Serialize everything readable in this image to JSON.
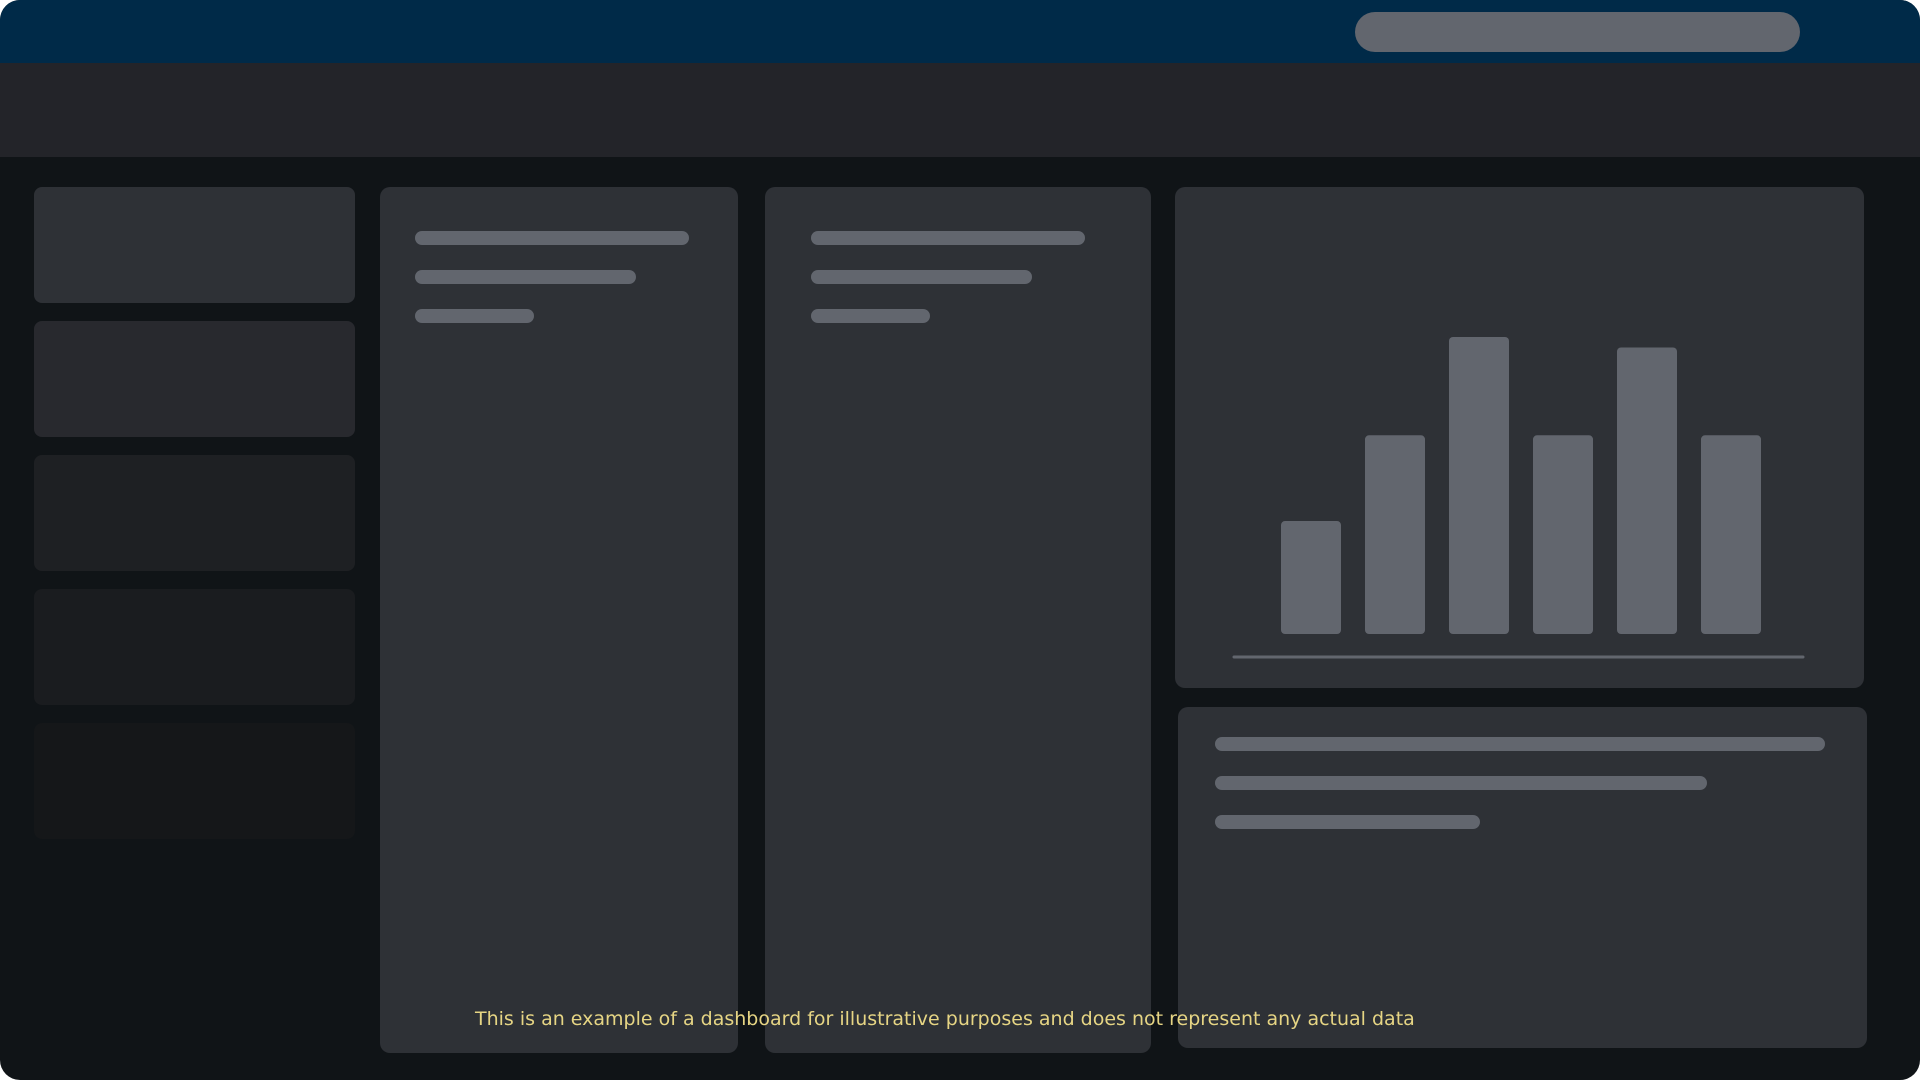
{
  "header": {
    "search_placeholder": ""
  },
  "nav": {
    "items": [
      {
        "color": "#2e3136"
      },
      {
        "color": "#28292e"
      },
      {
        "color": "#1e2023"
      },
      {
        "color": "#1a1c1f"
      },
      {
        "color": "#151719"
      }
    ]
  },
  "chart_data": {
    "type": "bar",
    "categories": [
      "",
      "",
      "",
      "",
      "",
      ""
    ],
    "values": [
      108,
      190,
      284,
      190,
      274,
      190
    ],
    "title": "",
    "xlabel": "",
    "ylabel": "",
    "ylim": [
      0,
      284
    ],
    "grid": false,
    "bar_color": "#62666e"
  },
  "footer": {
    "disclaimer": "This is an example of a dashboard for illustrative purposes and does not represent any actual data"
  },
  "colors": {
    "topbar": "#002a48",
    "subheader": "#232429",
    "background": "#101417",
    "panel": "#2e3136",
    "placeholder": "#62666e",
    "disclaimer": "#e6d584"
  }
}
